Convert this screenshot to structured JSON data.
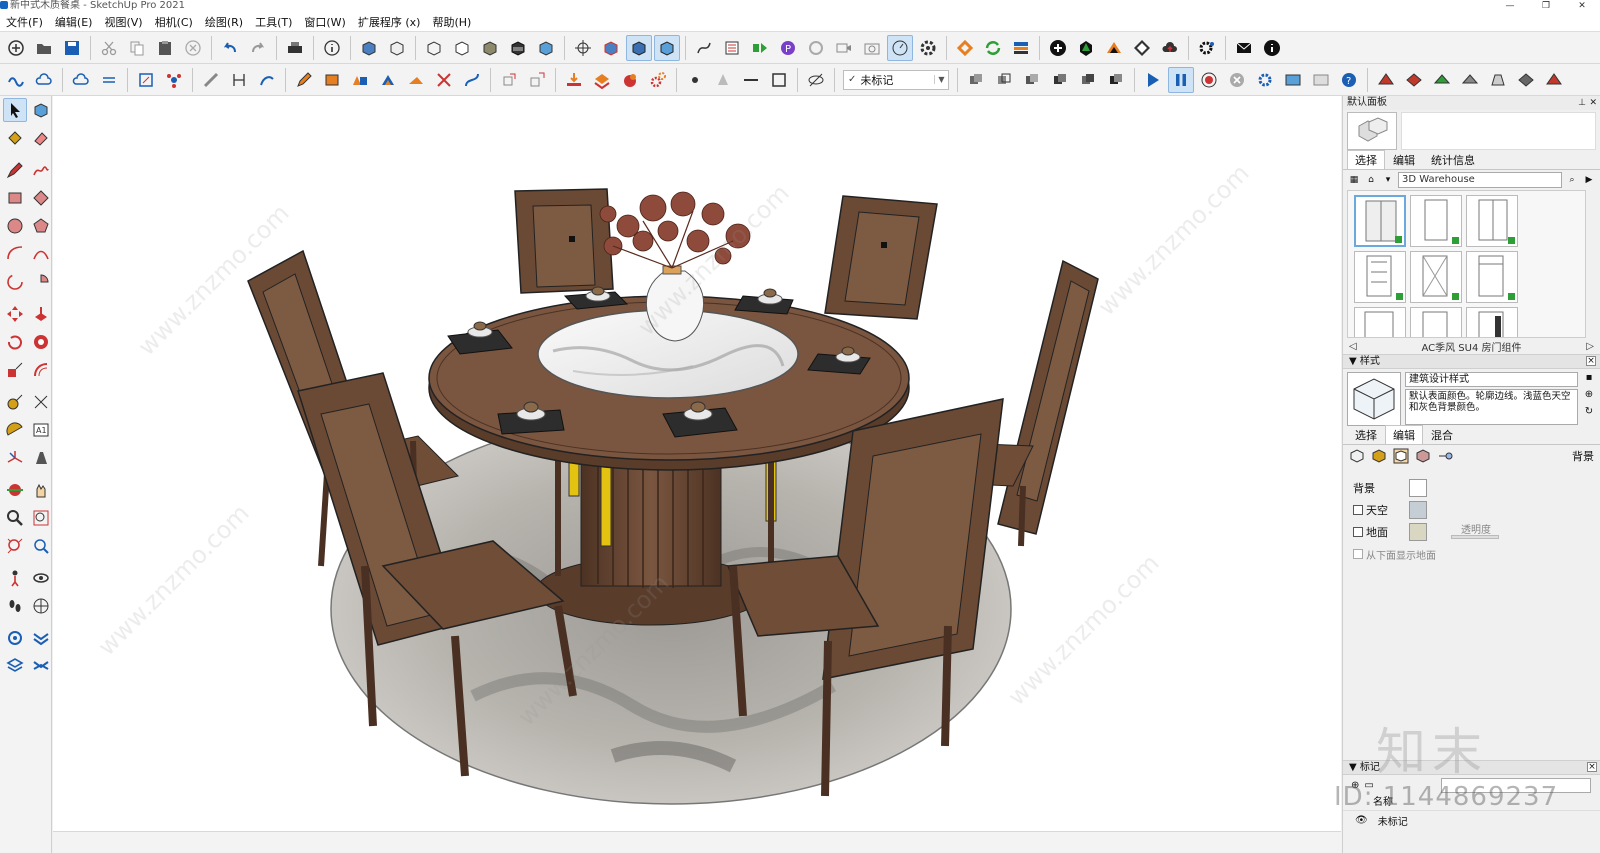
{
  "window": {
    "title": "新中式木质餐桌 - SketchUp Pro 2021"
  },
  "menu": {
    "items": [
      "文件(F)",
      "编辑(E)",
      "视图(V)",
      "相机(C)",
      "绘图(R)",
      "工具(T)",
      "窗口(W)",
      "扩展程序 (x)",
      "帮助(H)"
    ]
  },
  "toolbar": {
    "tag_select": "未标记"
  },
  "tray": {
    "title": "默认面板",
    "components": {
      "tabs": [
        "选择",
        "编辑",
        "统计信息"
      ],
      "search_value": "3D Warehouse",
      "collection_name": "AC季风 SU4 房门组件"
    },
    "styles": {
      "header": "样式",
      "style_name": "建筑设计样式",
      "style_desc": "默认表面颜色。轮廓边线。浅蓝色天空和灰色背景颜色。",
      "tabs": [
        "选择",
        "编辑",
        "混合"
      ],
      "section_label": "背景",
      "background_label": "背景",
      "sky_label": "天空",
      "ground_label": "地面",
      "opacity_label": "透明度",
      "show_ground_label": "从下面显示地面",
      "colors": {
        "background": "#ffffff",
        "sky": "#c5ced5",
        "ground": "#d9d6c1"
      }
    },
    "tags": {
      "header": "标记",
      "col_name": "名称",
      "row_name": "未标记"
    }
  },
  "watermark": {
    "logo": "知末",
    "id": "ID: 1144869237",
    "site": "www.znzmo.com"
  },
  "colors": {
    "viewport_bg": "#ffffff",
    "wood": "#6b4a35",
    "marble": "#f2f2f2",
    "rug": "#b8b6b2"
  }
}
